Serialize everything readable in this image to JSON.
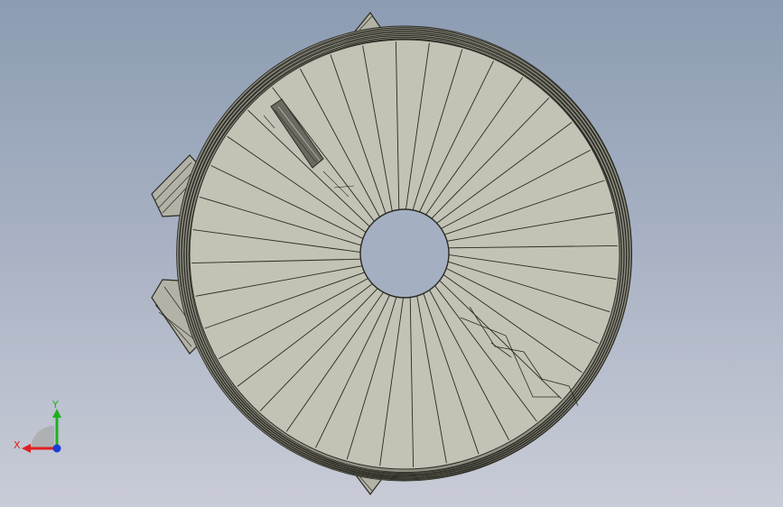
{
  "viewport": {
    "background_top": "#8c9cb2",
    "background_bottom": "#c9ccd7"
  },
  "model": {
    "face_color": "#c2c2b5",
    "edge_color": "#2a2a22",
    "rim_color": "#8f8f84",
    "hole_color": "#a4b0c2",
    "spoke_count": 40
  },
  "triad": {
    "x_label": "X",
    "y_label": "Y",
    "x_color": "#e02020",
    "y_color": "#20b020",
    "z_color": "#1c3cd8"
  }
}
